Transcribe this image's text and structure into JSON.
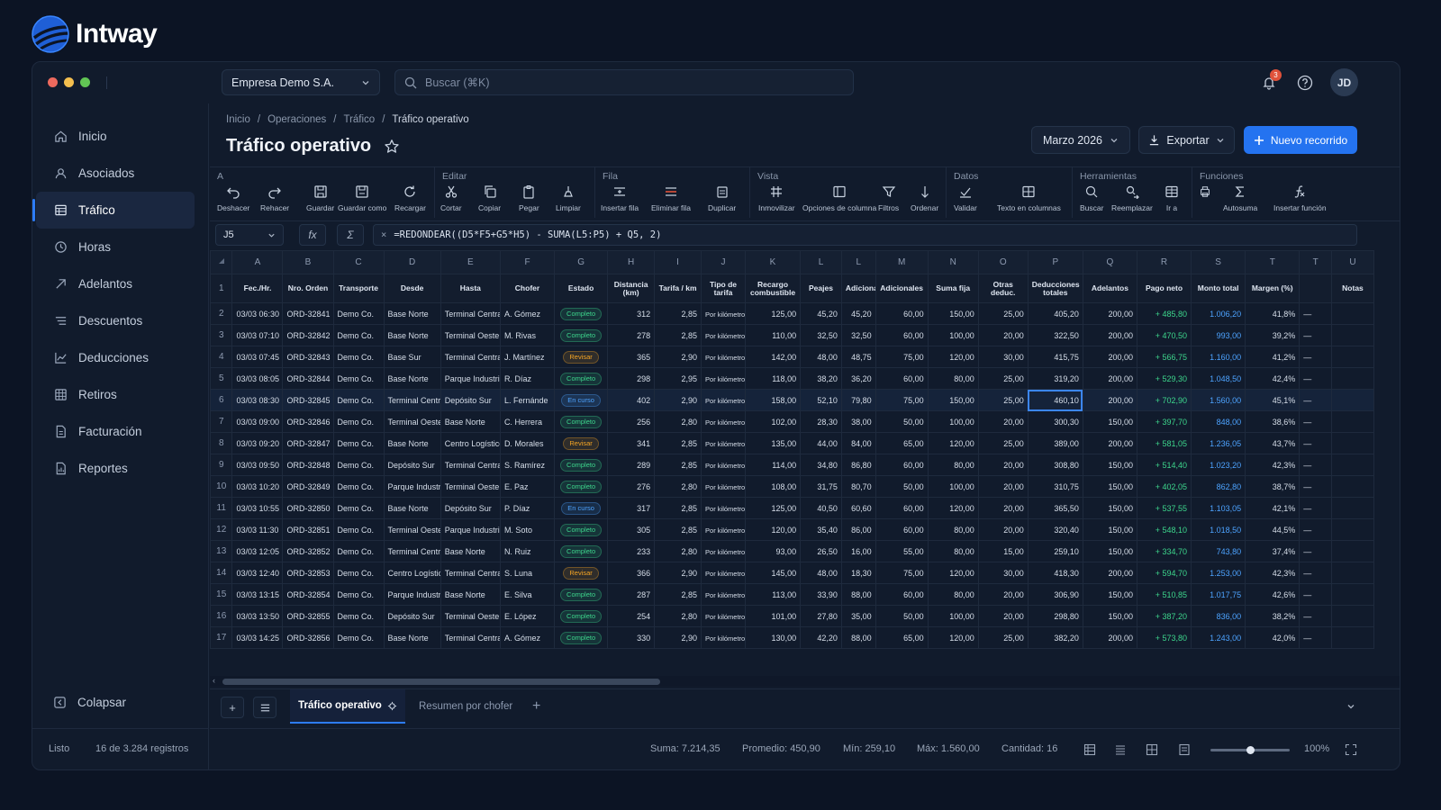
{
  "brand": {
    "name": "Intway"
  },
  "toolbar": {
    "company": "Empresa Demo S.A.",
    "search_placeholder": "Buscar (⌘K)",
    "notif_count": "3",
    "avatar": "JD"
  },
  "sidebar": {
    "items": [
      {
        "label": "Inicio",
        "icon": "home-icon"
      },
      {
        "label": "Asociados",
        "icon": "users-icon"
      },
      {
        "label": "Tráfico",
        "icon": "table-icon"
      },
      {
        "label": "Horas",
        "icon": "clock-icon"
      },
      {
        "label": "Adelantos",
        "icon": "arrow-icon"
      },
      {
        "label": "Descuentos",
        "icon": "list-icon"
      },
      {
        "label": "Deducciones",
        "icon": "chart-icon"
      },
      {
        "label": "Retiros",
        "icon": "grid-icon"
      },
      {
        "label": "Facturación",
        "icon": "doc-icon"
      },
      {
        "label": "Reportes",
        "icon": "report-icon"
      }
    ],
    "collapse": "Colapsar"
  },
  "breadcrumb": [
    "Inicio",
    "Operaciones",
    "Tráfico",
    "Tráfico operativo"
  ],
  "page": {
    "title": "Tráfico operativo"
  },
  "actions": {
    "month": "Marzo 2026",
    "export": "Exportar",
    "new": "Nuevo recorrido"
  },
  "ribbon": {
    "groups": [
      "A",
      "Editar",
      "Fila",
      "Vista",
      "Datos",
      "Herramientas",
      "Funciones"
    ],
    "buttons": [
      "Deshacer",
      "Rehacer",
      "Guardar",
      "Guardar como",
      "Recargar",
      "Cortar",
      "Copiar",
      "Pegar",
      "Limpiar",
      "Insertar fila",
      "Eliminar fila",
      "Duplicar",
      "Inmovilizar",
      "Opciones de columna",
      "Filtros",
      "Ordenar",
      "Validar",
      "Texto en columnas",
      "Buscar",
      "Reemplazar",
      "Ir a",
      "Autosuma",
      "Insertar función"
    ]
  },
  "formula_bar": {
    "cell": "J5",
    "fx": "fx",
    "sigma": "Σ",
    "cancel": "×",
    "formula": "=REDONDEAR((D5*F5+G5*H5) - SUMA(L5:P5) + Q5, 2)"
  },
  "columns": [
    "A",
    "B",
    "C",
    "D",
    "E",
    "F",
    "G",
    "H",
    "I",
    "J",
    "K",
    "L",
    "L",
    "M",
    "N",
    "O",
    "P",
    "Q",
    "R",
    "S",
    "T",
    "T",
    "U"
  ],
  "headers": [
    "Fec./Hr.",
    "Nro. Orden",
    "Transporte",
    "Desde",
    "Hasta",
    "Chofer",
    "Estado",
    "Distancia (km)",
    "Tarifa / km",
    "Tipo de tarifa",
    "Recargo combustible",
    "Peajes",
    "Adicionas",
    "Adicionales",
    "Suma fija",
    "Otras deduc.",
    "Deducciones totales",
    "Adelantos",
    "Pago neto",
    "Monto total",
    "Margen (%)",
    "",
    "Notas"
  ],
  "rows": [
    [
      "03/03 06:30",
      "ORD-32841",
      "Demo Co.",
      "Base Norte",
      "Terminal Central",
      "A. Gómez",
      "Completo",
      "312",
      "2,85",
      "Por kilómetro",
      "125,00",
      "45,20",
      "45,20",
      "60,00",
      "150,00",
      "25,00",
      "405,20",
      "200,00",
      "+ 485,80",
      "1.006,20",
      "41,8%",
      "—"
    ],
    [
      "03/03 07:10",
      "ORD-32842",
      "Demo Co.",
      "Base Norte",
      "Terminal Oeste",
      "M. Rivas",
      "Completo",
      "278",
      "2,85",
      "Por kilómetro",
      "110,00",
      "32,50",
      "32,50",
      "60,00",
      "100,00",
      "20,00",
      "322,50",
      "200,00",
      "+ 470,50",
      "993,00",
      "39,2%",
      "—"
    ],
    [
      "03/03 07:45",
      "ORD-32843",
      "Demo Co.",
      "Base Sur",
      "Terminal Central",
      "J. Martínez",
      "Revisar",
      "365",
      "2,90",
      "Por kilómetro",
      "142,00",
      "48,00",
      "48,75",
      "75,00",
      "120,00",
      "30,00",
      "415,75",
      "200,00",
      "+ 566,75",
      "1.160,00",
      "41,2%",
      "—"
    ],
    [
      "03/03 08:05",
      "ORD-32844",
      "Demo Co.",
      "Base Norte",
      "Parque Industrial",
      "R. Díaz",
      "Completo",
      "298",
      "2,95",
      "Por kilómetro",
      "118,00",
      "38,20",
      "36,20",
      "60,00",
      "80,00",
      "25,00",
      "319,20",
      "200,00",
      "+ 529,30",
      "1.048,50",
      "42,4%",
      "—"
    ],
    [
      "03/03 08:30",
      "ORD-32845",
      "Demo Co.",
      "Terminal Central",
      "Depósito Sur",
      "L. Fernánde",
      "En curso",
      "402",
      "2,90",
      "Por kilómetro",
      "158,00",
      "52,10",
      "79,80",
      "75,00",
      "150,00",
      "25,00",
      "460,10",
      "200,00",
      "+ 702,90",
      "1.560,00",
      "45,1%",
      "—"
    ],
    [
      "03/03 09:00",
      "ORD-32846",
      "Demo Co.",
      "Terminal Oeste",
      "Base Norte",
      "C. Herrera",
      "Completo",
      "256",
      "2,80",
      "Por kilómetro",
      "102,00",
      "28,30",
      "38,00",
      "50,00",
      "100,00",
      "20,00",
      "300,30",
      "150,00",
      "+ 397,70",
      "848,00",
      "38,6%",
      "—"
    ],
    [
      "03/03 09:20",
      "ORD-32847",
      "Demo Co.",
      "Base Norte",
      "Centro Logístico",
      "D. Morales",
      "Revisar",
      "341",
      "2,85",
      "Por kilómetro",
      "135,00",
      "44,00",
      "84,00",
      "65,00",
      "120,00",
      "25,00",
      "389,00",
      "200,00",
      "+ 581,05",
      "1.236,05",
      "43,7%",
      "—"
    ],
    [
      "03/03 09:50",
      "ORD-32848",
      "Demo Co.",
      "Depósito Sur",
      "Terminal Central",
      "S. Ramírez",
      "Completo",
      "289",
      "2,85",
      "Por kilómetro",
      "114,00",
      "34,80",
      "86,80",
      "60,00",
      "80,00",
      "20,00",
      "308,80",
      "150,00",
      "+ 514,40",
      "1.023,20",
      "42,3%",
      "—"
    ],
    [
      "03/03 10:20",
      "ORD-32849",
      "Demo Co.",
      "Parque Industrial",
      "Terminal Oeste",
      "E. Paz",
      "Completo",
      "276",
      "2,80",
      "Por kilómetro",
      "108,00",
      "31,75",
      "80,70",
      "50,00",
      "100,00",
      "20,00",
      "310,75",
      "150,00",
      "+ 402,05",
      "862,80",
      "38,7%",
      "—"
    ],
    [
      "03/03 10:55",
      "ORD-32850",
      "Demo Co.",
      "Base Norte",
      "Depósito Sur",
      "P. Díaz",
      "En curso",
      "317",
      "2,85",
      "Por kilómetro",
      "125,00",
      "40,50",
      "60,60",
      "60,00",
      "120,00",
      "20,00",
      "365,50",
      "150,00",
      "+ 537,55",
      "1.103,05",
      "42,1%",
      "—"
    ],
    [
      "03/03 11:30",
      "ORD-32851",
      "Demo Co.",
      "Terminal Oeste",
      "Parque Industrial",
      "M. Soto",
      "Completo",
      "305",
      "2,85",
      "Por kilómetro",
      "120,00",
      "35,40",
      "86,00",
      "60,00",
      "80,00",
      "20,00",
      "320,40",
      "150,00",
      "+ 548,10",
      "1.018,50",
      "44,5%",
      "—"
    ],
    [
      "03/03 12:05",
      "ORD-32852",
      "Demo Co.",
      "Terminal Central",
      "Base Norte",
      "N. Ruiz",
      "Completo",
      "233",
      "2,80",
      "Por kilómetro",
      "93,00",
      "26,50",
      "16,00",
      "55,00",
      "80,00",
      "15,00",
      "259,10",
      "150,00",
      "+ 334,70",
      "743,80",
      "37,4%",
      "—"
    ],
    [
      "03/03 12:40",
      "ORD-32853",
      "Demo Co.",
      "Centro Logístico",
      "Terminal Central",
      "S. Luna",
      "Revisar",
      "366",
      "2,90",
      "Por kilómetro",
      "145,00",
      "48,00",
      "18,30",
      "75,00",
      "120,00",
      "30,00",
      "418,30",
      "200,00",
      "+ 594,70",
      "1.253,00",
      "42,3%",
      "—"
    ],
    [
      "03/03 13:15",
      "ORD-32854",
      "Demo Co.",
      "Parque Industrial",
      "Base Norte",
      "E. Silva",
      "Completo",
      "287",
      "2,85",
      "Por kilómetro",
      "113,00",
      "33,90",
      "88,00",
      "60,00",
      "80,00",
      "20,00",
      "306,90",
      "150,00",
      "+ 510,85",
      "1.017,75",
      "42,6%",
      "—"
    ],
    [
      "03/03 13:50",
      "ORD-32855",
      "Demo Co.",
      "Depósito Sur",
      "Terminal Oeste",
      "E. López",
      "Completo",
      "254",
      "2,80",
      "Por kilómetro",
      "101,00",
      "27,80",
      "35,00",
      "50,00",
      "100,00",
      "20,00",
      "298,80",
      "150,00",
      "+ 387,20",
      "836,00",
      "38,2%",
      "—"
    ],
    [
      "03/03 14:25",
      "ORD-32856",
      "Demo Co.",
      "Base Norte",
      "Terminal Central",
      "A. Gómez",
      "Completo",
      "330",
      "2,90",
      "Por kilómetro",
      "130,00",
      "42,20",
      "88,00",
      "65,00",
      "120,00",
      "25,00",
      "382,20",
      "200,00",
      "+ 573,80",
      "1.243,00",
      "42,0%",
      "—"
    ]
  ],
  "row_numbers": [
    "1",
    "2",
    "3",
    "4",
    "5",
    "6",
    "7",
    "8",
    "9",
    "10",
    "11",
    "12",
    "13",
    "14",
    "15",
    "16",
    "17"
  ],
  "active_row": 4,
  "status_colors": {
    "Completo": "#3dd68c",
    "Revisar": "#f5a524",
    "En curso": "#4da3ff"
  },
  "sheets": {
    "active": "Tráfico operativo",
    "other": "Resumen por chofer"
  },
  "status": {
    "ready": "Listo",
    "records": "16 de 3.284 registros",
    "sum": "Suma: 7.214,35",
    "avg": "Promedio: 450,90",
    "min": "Mín: 259,10",
    "max": "Máx: 1.560,00",
    "count": "Cantidad: 16",
    "zoom": "100%",
    "zoom_level": 0.5
  },
  "colors": {
    "accent": "#2473f0",
    "background": "#0c1424"
  }
}
